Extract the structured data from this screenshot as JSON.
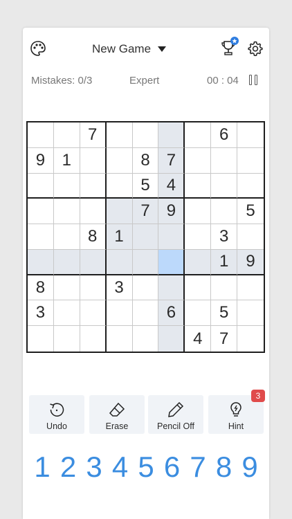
{
  "header": {
    "title": "New Game",
    "icons": [
      "palette-icon",
      "trophy-icon",
      "gear-icon"
    ]
  },
  "status": {
    "mistakes": "Mistakes: 0/3",
    "difficulty": "Expert",
    "timer": "00 : 04"
  },
  "board": {
    "rows": [
      [
        "",
        "",
        "7",
        "",
        "",
        "",
        "",
        "6",
        ""
      ],
      [
        "9",
        "1",
        "",
        "",
        "8",
        "7",
        "",
        "",
        ""
      ],
      [
        "",
        "",
        "",
        "",
        "5",
        "4",
        "",
        "",
        ""
      ],
      [
        "",
        "",
        "",
        "",
        "7",
        "9",
        "",
        "",
        "5"
      ],
      [
        "",
        "",
        "8",
        "1",
        "",
        "",
        "",
        "3",
        ""
      ],
      [
        "",
        "",
        "",
        "",
        "",
        "",
        "",
        "1",
        "9"
      ],
      [
        "8",
        "",
        "",
        "3",
        "",
        "",
        "",
        "",
        ""
      ],
      [
        "3",
        "",
        "",
        "",
        "",
        "6",
        "",
        "5",
        ""
      ],
      [
        "",
        "",
        "",
        "",
        "",
        "",
        "4",
        "7",
        ""
      ]
    ],
    "selected": {
      "row": 5,
      "col": 5
    }
  },
  "actions": {
    "undo": "Undo",
    "erase": "Erase",
    "pencil": "Pencil Off",
    "hint": "Hint",
    "hint_count": "3"
  },
  "numpad": [
    "1",
    "2",
    "3",
    "4",
    "5",
    "6",
    "7",
    "8",
    "9"
  ],
  "colors": {
    "accent": "#3b8de0",
    "selected_cell": "#bcd9fb",
    "highlight": "#e4e8ee",
    "badge": "#e04b4b"
  }
}
